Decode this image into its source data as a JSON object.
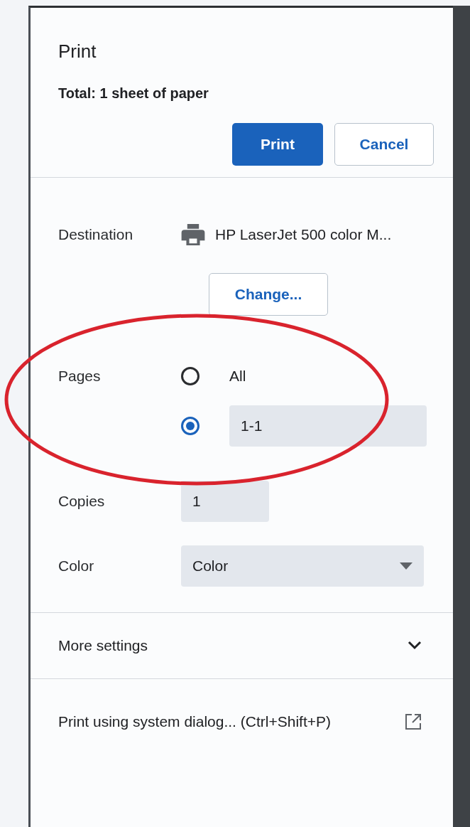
{
  "title": "Print",
  "total": "Total: 1 sheet of paper",
  "buttons": [
    {
      "label": "Print",
      "kind": "primary"
    },
    {
      "label": "Cancel",
      "kind": "secondary"
    }
  ],
  "destination": {
    "label": "Destination",
    "printer": "HP LaserJet 500 color M...",
    "change": "Change..."
  },
  "pages": {
    "label": "Pages",
    "options": [
      {
        "kind": "text",
        "label": "All",
        "selected": false
      },
      {
        "kind": "field",
        "value": "1-1",
        "selected": true
      }
    ]
  },
  "copies": {
    "label": "Copies",
    "value": "1"
  },
  "color": {
    "label": "Color",
    "value": "Color"
  },
  "more_settings": {
    "label": "More settings",
    "expanded": false
  },
  "system_dialog": {
    "label": "Print using system dialog... (Ctrl+Shift+P)"
  },
  "annotation": {
    "kind": "ellipse",
    "color": "#d9232d"
  }
}
